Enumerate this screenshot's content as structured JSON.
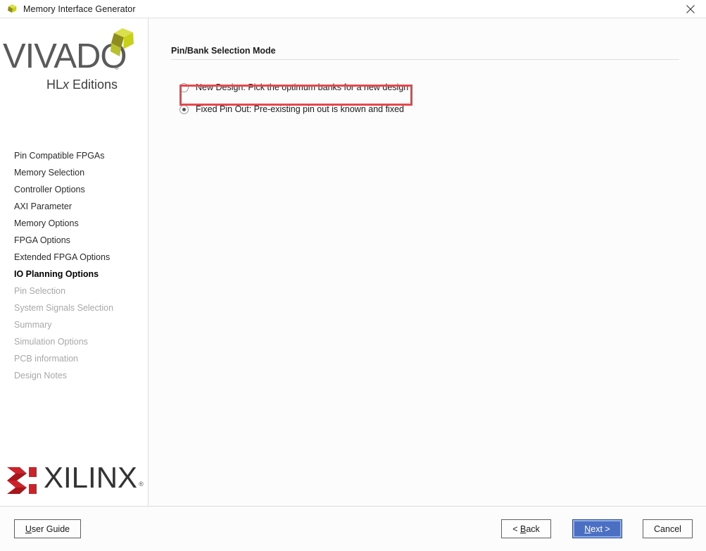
{
  "window": {
    "title": "Memory Interface Generator",
    "icon": "vivado-app-icon",
    "close_icon": "close-icon"
  },
  "branding": {
    "vivado_wordmark": "VIVADO",
    "vivado_registered": "®",
    "vivado_subtitle_pre": "HL",
    "vivado_subtitle_italic": "x",
    "vivado_subtitle_post": " Editions",
    "vivado_mark_icon": "vivado-pinwheel-icon",
    "vivado_mark_colors": [
      "#c8d117",
      "#8d8c1f",
      "#d9e04b"
    ],
    "xilinx_wordmark": "XILINX",
    "xilinx_registered": "®",
    "xilinx_mark_icon": "xilinx-chevron-icon",
    "xilinx_mark_color": "#cc2229",
    "vivado_text_color": "#5a5a5a",
    "xilinx_text_color": "#333333"
  },
  "sidebar": {
    "items": [
      {
        "label": "Pin Compatible FPGAs",
        "state": "normal"
      },
      {
        "label": "Memory Selection",
        "state": "normal"
      },
      {
        "label": "Controller Options",
        "state": "normal"
      },
      {
        "label": "AXI Parameter",
        "state": "normal"
      },
      {
        "label": "Memory Options",
        "state": "normal"
      },
      {
        "label": "FPGA Options",
        "state": "normal"
      },
      {
        "label": "Extended FPGA Options",
        "state": "normal"
      },
      {
        "label": "IO Planning Options",
        "state": "active"
      },
      {
        "label": "Pin Selection",
        "state": "disabled"
      },
      {
        "label": "System Signals Selection",
        "state": "disabled"
      },
      {
        "label": "Summary",
        "state": "disabled"
      },
      {
        "label": "Simulation Options",
        "state": "disabled"
      },
      {
        "label": "PCB information",
        "state": "disabled"
      },
      {
        "label": "Design Notes",
        "state": "disabled"
      }
    ]
  },
  "main": {
    "section_title": "Pin/Bank Selection Mode",
    "radio_options": [
      {
        "label": "New Design: Pick the optimum banks for a new design",
        "selected": false
      },
      {
        "label": "Fixed Pin Out: Pre-existing pin out is known and fixed",
        "selected": true
      }
    ],
    "annotation": {
      "type": "rectangle-highlight",
      "color": "#e8474c",
      "target": "Fixed Pin Out: Pre-existing pin out is known and fixed"
    }
  },
  "footer": {
    "user_guide": {
      "before": "",
      "mnemonic": "U",
      "after": "ser Guide"
    },
    "back": {
      "before": "< ",
      "mnemonic": "B",
      "after": "ack"
    },
    "next": {
      "before": "",
      "mnemonic": "N",
      "after": "ext >"
    },
    "cancel": {
      "before": "Cancel",
      "mnemonic": "",
      "after": ""
    },
    "next_button_color": "#4a6fc3",
    "next_button_text_color": "#ffffff"
  }
}
